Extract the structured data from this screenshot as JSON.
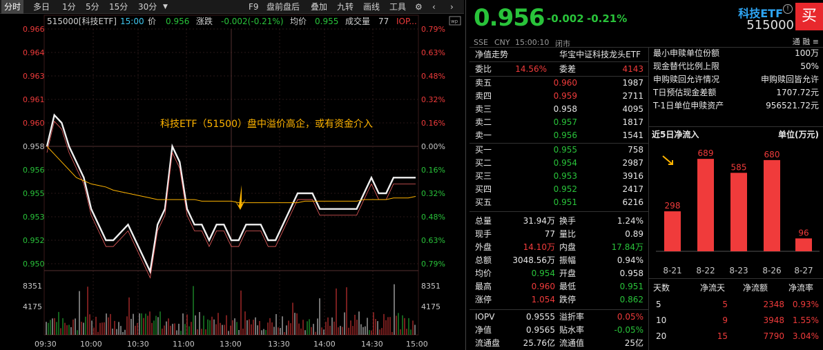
{
  "toolbar": {
    "left": [
      "分时",
      "多日",
      "1分",
      "5分",
      "15分",
      "30分"
    ],
    "right": [
      "F9",
      "盘前盘后",
      "叠加",
      "九转",
      "画线",
      "工具"
    ]
  },
  "chart_header": {
    "code": "515000[科技ETF]",
    "time": "15:00",
    "price_label": "价",
    "price": "0.956",
    "change_label": "涨跌",
    "change": "-0.002(-0.21%)",
    "avg_label": "均价",
    "avg": "0.955",
    "vol_label": "成交量",
    "vol": "77",
    "iop": "IOP..."
  },
  "annotation": "科技ETF（51500）盘中溢价高企，或有资金介入",
  "y_prices": [
    "0.966",
    "0.964",
    "0.963",
    "0.961",
    "0.960",
    "0.958",
    "0.956",
    "0.955",
    "0.953",
    "0.952",
    "0.950"
  ],
  "y_pcts": [
    "0.79%",
    "0.63%",
    "0.48%",
    "0.32%",
    "0.16%",
    "0.00%",
    "0.16%",
    "0.32%",
    "0.48%",
    "0.63%",
    "0.79%"
  ],
  "vol_ticks": [
    "8351",
    "4175"
  ],
  "x_times": [
    "09:30",
    "10:00",
    "10:30",
    "11:00",
    "13:00",
    "13:30",
    "14:00",
    "14:30",
    "15:00"
  ],
  "chart_data": {
    "type": "line",
    "series": [
      {
        "name": "价",
        "y": [
          0.958,
          0.96,
          0.9595,
          0.958,
          0.957,
          0.956,
          0.954,
          0.953,
          0.952,
          0.952,
          0.9525,
          0.953,
          0.952,
          0.951,
          0.95,
          0.953,
          0.954,
          0.958,
          0.957,
          0.954,
          0.953,
          0.953,
          0.952,
          0.953,
          0.953,
          0.952,
          0.952,
          0.953,
          0.953,
          0.953,
          0.952,
          0.952,
          0.953,
          0.954,
          0.955,
          0.955,
          0.955,
          0.954,
          0.954,
          0.954,
          0.954,
          0.954,
          0.954,
          0.955,
          0.956,
          0.955,
          0.955,
          0.956,
          0.956,
          0.956,
          0.956
        ]
      },
      {
        "name": "均价",
        "y": [
          0.958,
          0.9575,
          0.957,
          0.9565,
          0.956,
          0.9558,
          0.9556,
          0.9555,
          0.9554,
          0.9552,
          0.9551,
          0.955,
          0.9549,
          0.9548,
          0.9547,
          0.9546,
          0.9546,
          0.9546,
          0.9546,
          0.9546,
          0.9546,
          0.9545,
          0.9545,
          0.9545,
          0.9545,
          0.9545,
          0.9544,
          0.9544,
          0.9544,
          0.9544,
          0.9544,
          0.9544,
          0.9544,
          0.9544,
          0.9544,
          0.9545,
          0.9545,
          0.9545,
          0.9545,
          0.9545,
          0.9545,
          0.9545,
          0.9545,
          0.9546,
          0.9546,
          0.9546,
          0.9546,
          0.9547,
          0.9547,
          0.9547,
          0.9548
        ]
      }
    ],
    "ylim": [
      0.9505,
      0.9655
    ]
  },
  "quote": {
    "price": "0.956",
    "change": "-0.002",
    "pct": "-0.21%",
    "exchange": "SSE",
    "currency": "CNY",
    "datetime": "15:00:10",
    "status": "闭市",
    "name": "科技ETF",
    "code": "515000",
    "buy": "买",
    "tags": "通 融 ≡"
  },
  "book_head": {
    "left": "净值走势",
    "right": "华宝中证科技龙头ETF"
  },
  "ratio": {
    "wb_label": "委比",
    "wb": "14.56%",
    "wc_label": "委差",
    "wc": "4143"
  },
  "asks": [
    {
      "label": "卖五",
      "price": "0.960",
      "vol": "1987",
      "c": "r"
    },
    {
      "label": "卖四",
      "price": "0.959",
      "vol": "2711",
      "c": "r"
    },
    {
      "label": "卖三",
      "price": "0.958",
      "vol": "4095",
      "c": "w"
    },
    {
      "label": "卖二",
      "price": "0.957",
      "vol": "1817",
      "c": "g"
    },
    {
      "label": "卖一",
      "price": "0.956",
      "vol": "1541",
      "c": "g"
    }
  ],
  "bids": [
    {
      "label": "买一",
      "price": "0.955",
      "vol": "758",
      "c": "g"
    },
    {
      "label": "买二",
      "price": "0.954",
      "vol": "2987",
      "c": "g"
    },
    {
      "label": "买三",
      "price": "0.953",
      "vol": "3916",
      "c": "g"
    },
    {
      "label": "买四",
      "price": "0.952",
      "vol": "2417",
      "c": "g"
    },
    {
      "label": "买五",
      "price": "0.951",
      "vol": "6216",
      "c": "g"
    }
  ],
  "stats": [
    {
      "l1": "总量",
      "v1": "31.94万",
      "c1": "w",
      "l2": "换手",
      "v2": "1.24%",
      "c2": "w"
    },
    {
      "l1": "现手",
      "v1": "77",
      "c1": "w",
      "l2": "量比",
      "v2": "0.89",
      "c2": "w"
    },
    {
      "l1": "外盘",
      "v1": "14.10万",
      "c1": "r",
      "l2": "内盘",
      "v2": "17.84万",
      "c2": "g"
    },
    {
      "l1": "总额",
      "v1": "3048.56万",
      "c1": "w",
      "l2": "振幅",
      "v2": "0.94%",
      "c2": "w"
    },
    {
      "l1": "均价",
      "v1": "0.954",
      "c1": "g",
      "l2": "开盘",
      "v2": "0.958",
      "c2": "w"
    },
    {
      "l1": "最高",
      "v1": "0.960",
      "c1": "r",
      "l2": "最低",
      "v2": "0.951",
      "c2": "g"
    },
    {
      "l1": "涨停",
      "v1": "1.054",
      "c1": "r",
      "l2": "跌停",
      "v2": "0.862",
      "c2": "g"
    }
  ],
  "iopv": [
    {
      "l1": "IOPV",
      "v1": "0.9555",
      "c1": "w",
      "l2": "溢折率",
      "v2": "0.05%",
      "c2": "r"
    },
    {
      "l1": "净值",
      "v1": "0.9565",
      "c1": "w",
      "l2": "贴水率",
      "v2": "-0.05%",
      "c2": "g"
    },
    {
      "l1": "流通盘",
      "v1": "25.76亿",
      "c1": "w",
      "l2": "流通值",
      "v2": "25亿",
      "c2": "w"
    }
  ],
  "subscription": [
    {
      "label": "最小申赎单位份额",
      "value": "100万"
    },
    {
      "label": "现金替代比例上限",
      "value": "50%"
    },
    {
      "label": "申购赎回允许情况",
      "value": "申购赎回皆允许"
    },
    {
      "label": "T日预估现金差额",
      "value": "1707.72元"
    },
    {
      "label": "T-1日单位申赎资产",
      "value": "956521.72元"
    }
  ],
  "flow_title": "近5日净流入",
  "flow_unit": "单位(万元)",
  "flow_chart": {
    "type": "bar",
    "categories": [
      "8-21",
      "8-22",
      "8-23",
      "8-26",
      "8-27"
    ],
    "values": [
      298,
      689,
      585,
      680,
      96
    ]
  },
  "flow_table": {
    "headers": [
      "天数",
      "净流天",
      "净流额",
      "净流率"
    ],
    "rows": [
      [
        "5",
        "5",
        "2348",
        "0.93%"
      ],
      [
        "10",
        "9",
        "3948",
        "1.55%"
      ],
      [
        "20",
        "15",
        "7790",
        "3.04%"
      ]
    ]
  },
  "colors": {
    "up": "#f03b3b",
    "down": "#29c33a",
    "avg": "#ffb400",
    "bg": "#000000"
  }
}
